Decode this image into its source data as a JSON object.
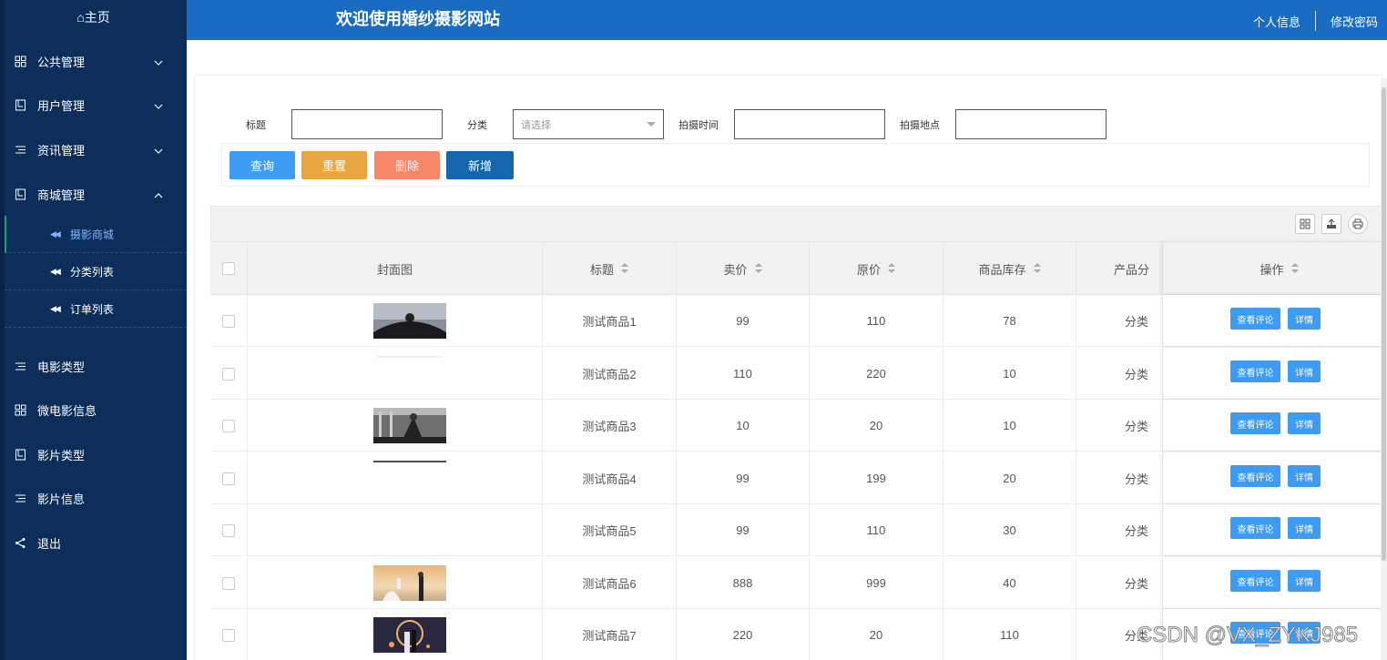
{
  "sidebar": {
    "home": "⌂主页",
    "menus": [
      {
        "label": "公共管理",
        "icon": "grid-icon",
        "expanded": false
      },
      {
        "label": "用户管理",
        "icon": "book-icon",
        "expanded": false
      },
      {
        "label": "资讯管理",
        "icon": "list-icon",
        "expanded": false
      },
      {
        "label": "商城管理",
        "icon": "book-icon",
        "expanded": true
      }
    ],
    "sub_items": [
      {
        "label": "摄影商城",
        "active": true
      },
      {
        "label": "分类列表",
        "active": false
      },
      {
        "label": "订单列表",
        "active": false
      }
    ],
    "lower_menus": [
      {
        "label": "电影类型",
        "icon": "list-icon"
      },
      {
        "label": "微电影信息",
        "icon": "grid-icon"
      },
      {
        "label": "影片类型",
        "icon": "book-icon"
      },
      {
        "label": "影片信息",
        "icon": "list-icon"
      },
      {
        "label": "退出",
        "icon": "share-icon"
      }
    ]
  },
  "header": {
    "title": "欢迎使用婚纱摄影网站",
    "profile": "个人信息",
    "password": "修改密码"
  },
  "search": {
    "title_label": "标题",
    "category_label": "分类",
    "category_placeholder": "请选择",
    "time_label": "拍摄时间",
    "place_label": "拍摄地点",
    "title_value": "",
    "time_value": "",
    "place_value": ""
  },
  "buttons": {
    "query": "查询",
    "reset": "重置",
    "delete": "删除",
    "add": "新增",
    "colors": {
      "query": "#3f9cf5",
      "reset": "#e9a53f",
      "delete": "#f5876a",
      "add": "#1566ae"
    }
  },
  "table": {
    "headers": {
      "cover": "封面图",
      "title": "标题",
      "price": "卖价",
      "original": "原价",
      "stock": "商品库存",
      "category": "产品分",
      "actions": "操作"
    },
    "action_labels": {
      "comments": "查看评论",
      "detail": "详情"
    },
    "rows": [
      {
        "title": "测试商品1",
        "price": "99",
        "original": "110",
        "stock": "78",
        "category": "分类",
        "cover": "dark"
      },
      {
        "title": "测试商品2",
        "price": "110",
        "original": "220",
        "stock": "10",
        "category": "分类",
        "cover": "line"
      },
      {
        "title": "测试商品3",
        "price": "10",
        "original": "20",
        "stock": "10",
        "category": "分类",
        "cover": "bw"
      },
      {
        "title": "测试商品4",
        "price": "99",
        "original": "199",
        "stock": "20",
        "category": "分类",
        "cover": "line2"
      },
      {
        "title": "测试商品5",
        "price": "99",
        "original": "110",
        "stock": "30",
        "category": "分类",
        "cover": "none"
      },
      {
        "title": "测试商品6",
        "price": "888",
        "original": "999",
        "stock": "40",
        "category": "分类",
        "cover": "beach"
      },
      {
        "title": "测试商品7",
        "price": "220",
        "original": "20",
        "stock": "110",
        "category": "分类",
        "cover": "night"
      }
    ]
  },
  "watermark": "CSDN @VX_ZYKJ985"
}
